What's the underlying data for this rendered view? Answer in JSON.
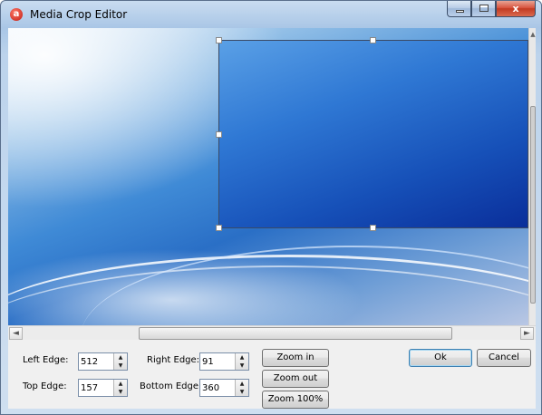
{
  "window": {
    "title": "Media Crop Editor",
    "app_icon_glyph": "a",
    "caption": {
      "minimize": "minimize-icon",
      "maximize": "maximize-icon",
      "close_glyph": "x"
    }
  },
  "scrollbars": {
    "left_arrow": "◄",
    "right_arrow": "►",
    "up_arrow": "▲"
  },
  "fields": {
    "left_edge": {
      "label": "Left Edge:",
      "value": "512"
    },
    "top_edge": {
      "label": "Top Edge:",
      "value": "157"
    },
    "right_edge": {
      "label": "Right Edge:",
      "value": "91"
    },
    "bottom_edge": {
      "label": "Bottom Edge:",
      "value": "360"
    }
  },
  "spin_glyphs": {
    "up": "▲",
    "down": "▼"
  },
  "buttons": {
    "zoom_in": "Zoom in",
    "zoom_out": "Zoom out",
    "zoom_100": "Zoom 100%",
    "ok": "Ok",
    "cancel": "Cancel"
  },
  "colors": {
    "crop_border": "#3a4a66",
    "close_button": "#c23a22",
    "default_button_border": "#3c7fb1"
  }
}
